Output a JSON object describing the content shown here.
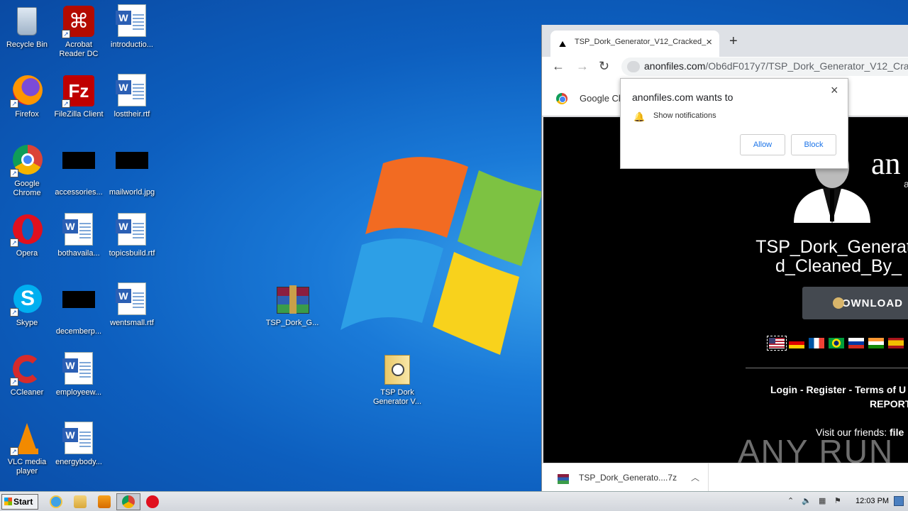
{
  "desktop": {
    "icons": [
      {
        "label": "Recycle Bin",
        "icon": "recycle-bin-icon"
      },
      {
        "label": "Acrobat Reader DC",
        "icon": "acrobat-icon"
      },
      {
        "label": "introductio...",
        "icon": "word-doc-icon"
      },
      {
        "label": "Firefox",
        "icon": "firefox-icon"
      },
      {
        "label": "FileZilla Client",
        "icon": "filezilla-icon"
      },
      {
        "label": "losttheir.rtf",
        "icon": "word-doc-icon"
      },
      {
        "label": "Google Chrome",
        "icon": "chrome-icon"
      },
      {
        "label": "accessories...",
        "icon": "image-thumbnail-icon"
      },
      {
        "label": "mailworld.jpg",
        "icon": "image-thumbnail-icon"
      },
      {
        "label": "Opera",
        "icon": "opera-icon"
      },
      {
        "label": "bothavaila...",
        "icon": "word-doc-icon"
      },
      {
        "label": "topicsbuild.rtf",
        "icon": "word-doc-icon"
      },
      {
        "label": "Skype",
        "icon": "skype-icon"
      },
      {
        "label": "decemberp...",
        "icon": "image-thumbnail-icon"
      },
      {
        "label": "wentsmall.rtf",
        "icon": "word-doc-icon"
      },
      {
        "label": "CCleaner",
        "icon": "ccleaner-icon"
      },
      {
        "label": "employeew...",
        "icon": "word-doc-icon"
      },
      {
        "label": "VLC media player",
        "icon": "vlc-icon"
      },
      {
        "label": "energybody...",
        "icon": "word-doc-icon"
      },
      {
        "label": "TSP_Dork_G...",
        "icon": "winrar-archive-icon"
      },
      {
        "label": "TSP Dork Generator V...",
        "icon": "folder-icon"
      }
    ]
  },
  "browser": {
    "tab_title": "TSP_Dork_Generator_V12_Cracked_",
    "url_domain": "anonfiles.com",
    "url_path": "/Ob6dF017y7/TSP_Dork_Generator_V12_Crac",
    "infobar_text": "Google Ch",
    "page": {
      "brand": "an",
      "brand_sub": "a",
      "title_line1": "TSP_Dork_Generato",
      "title_line2": "d_Cleaned_By_",
      "download_label": "DOWNLOAD",
      "links": "Login - Register - Terms of U",
      "report": "REPORT",
      "friends_prefix": "Visit our friends: ",
      "friends_link": "file"
    },
    "download_bar": {
      "filename": "TSP_Dork_Generato....7z"
    }
  },
  "notification": {
    "title": "anonfiles.com wants to",
    "permission": "Show notifications",
    "allow": "Allow",
    "block": "Block"
  },
  "watermark": "ANY RUN",
  "taskbar": {
    "start": "Start",
    "clock": "12:03 PM"
  }
}
